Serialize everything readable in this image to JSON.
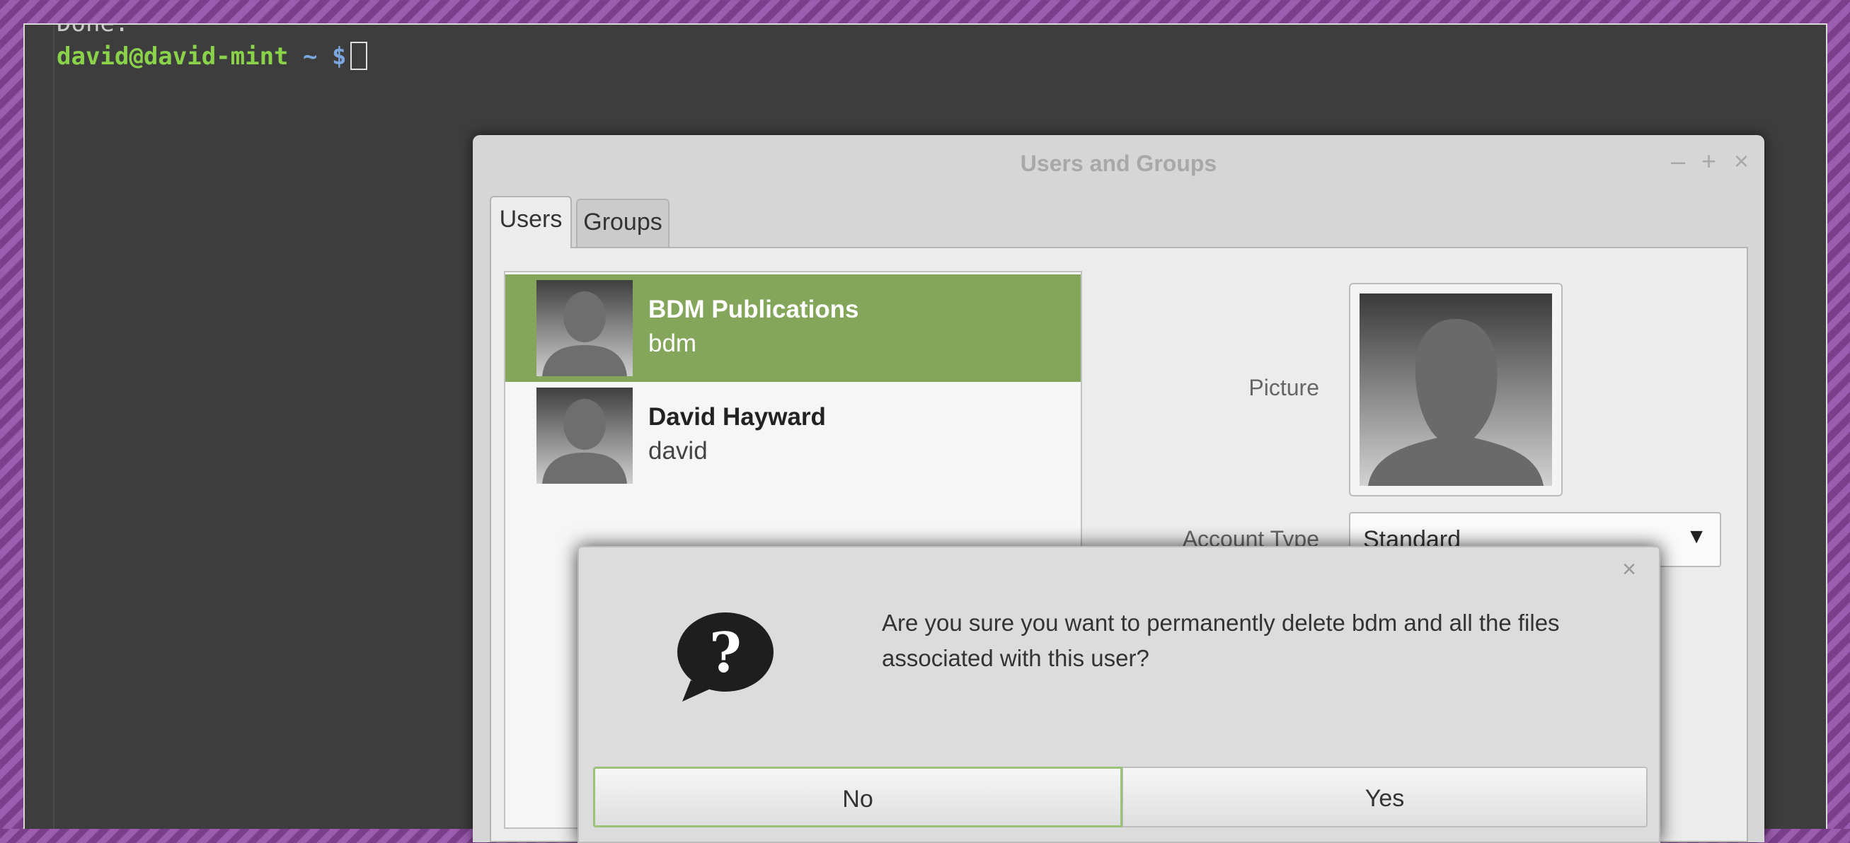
{
  "terminal": {
    "previous_output": "Done.",
    "prompt_user_host": "david@david-mint",
    "prompt_path": "~ $"
  },
  "users_window": {
    "title": "Users and Groups",
    "controls": {
      "minimize": "–",
      "maximize": "+",
      "close": "×"
    },
    "tabs": [
      {
        "label": "Users",
        "active": true
      },
      {
        "label": "Groups",
        "active": false
      }
    ],
    "users": [
      {
        "full_name": "BDM Publications",
        "login": "bdm",
        "selected": true
      },
      {
        "full_name": "David Hayward",
        "login": "david",
        "selected": false
      }
    ],
    "picture_label": "Picture",
    "account_type_label": "Account Type",
    "account_type_value": "Standard"
  },
  "dialog": {
    "close": "×",
    "icon": "question-icon",
    "message": "Are you sure you want to permanently delete bdm and all the files associated with this user?",
    "no_label": "No",
    "yes_label": "Yes"
  },
  "colors": {
    "selection": "#84a65a",
    "prompt_green": "#8ad24a",
    "prompt_blue": "#7ba6e0",
    "terminal_bg": "#3d3d3d",
    "desktop_purple": "#8a4a9c"
  }
}
